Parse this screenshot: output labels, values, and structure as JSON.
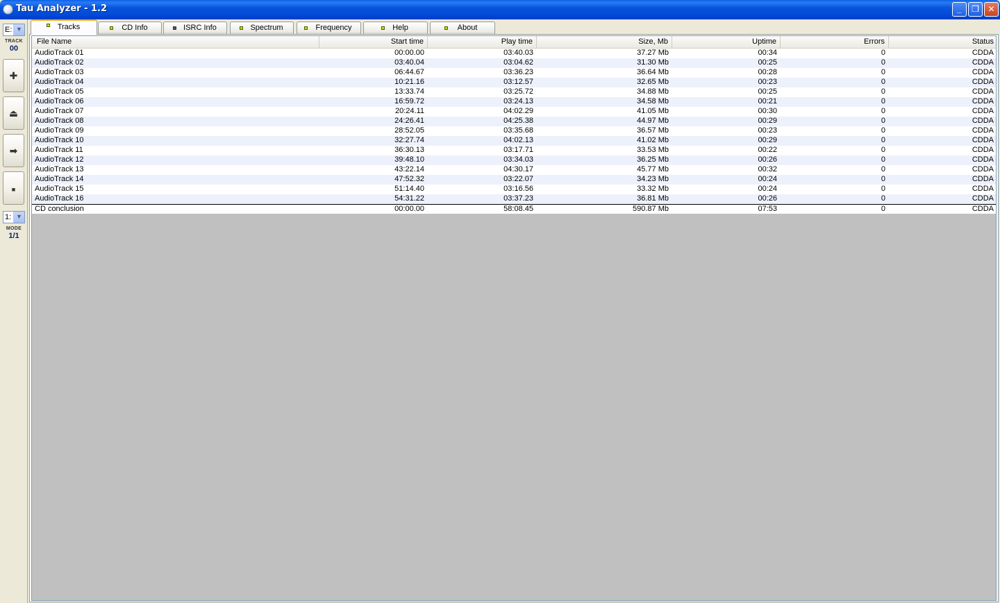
{
  "window": {
    "title": "Tau Analyzer - 1.2",
    "min_glyph": "_",
    "max_glyph": "❐",
    "close_glyph": "✕"
  },
  "sidebar": {
    "drive_value": "E:",
    "track_caption": "TRACK",
    "track_number": "00",
    "buttons": [
      {
        "name": "add",
        "glyph": "✚"
      },
      {
        "name": "eject",
        "glyph": "⏏"
      },
      {
        "name": "play",
        "glyph": "➡"
      },
      {
        "name": "stop",
        "glyph": "■"
      }
    ],
    "mode_value": "1:",
    "mode_caption": "MODE",
    "mode_value_big": "1/1"
  },
  "tabs": [
    {
      "label": "Tracks",
      "active": true,
      "indicator": "green"
    },
    {
      "label": "CD Info",
      "active": false,
      "indicator": "green"
    },
    {
      "label": "ISRC Info",
      "active": false,
      "indicator": "dark"
    },
    {
      "label": "Spectrum",
      "active": false,
      "indicator": "green"
    },
    {
      "label": "Frequency",
      "active": false,
      "indicator": "green"
    },
    {
      "label": "Help",
      "active": false,
      "indicator": "green"
    },
    {
      "label": "About",
      "active": false,
      "indicator": "green"
    }
  ],
  "table": {
    "columns": [
      "File Name",
      "Start time",
      "Play time",
      "Size, Mb",
      "Uptime",
      "Errors",
      "Status"
    ],
    "rows": [
      [
        "AudioTrack 01",
        "00:00.00",
        "03:40.03",
        "37.27 Mb",
        "00:34",
        "0",
        "CDDA"
      ],
      [
        "AudioTrack 02",
        "03:40.04",
        "03:04.62",
        "31.30 Mb",
        "00:25",
        "0",
        "CDDA"
      ],
      [
        "AudioTrack 03",
        "06:44.67",
        "03:36.23",
        "36.64 Mb",
        "00:28",
        "0",
        "CDDA"
      ],
      [
        "AudioTrack 04",
        "10:21.16",
        "03:12.57",
        "32.65 Mb",
        "00:23",
        "0",
        "CDDA"
      ],
      [
        "AudioTrack 05",
        "13:33.74",
        "03:25.72",
        "34.88 Mb",
        "00:25",
        "0",
        "CDDA"
      ],
      [
        "AudioTrack 06",
        "16:59.72",
        "03:24.13",
        "34.58 Mb",
        "00:21",
        "0",
        "CDDA"
      ],
      [
        "AudioTrack 07",
        "20:24.11",
        "04:02.29",
        "41.05 Mb",
        "00:30",
        "0",
        "CDDA"
      ],
      [
        "AudioTrack 08",
        "24:26.41",
        "04:25.38",
        "44.97 Mb",
        "00:29",
        "0",
        "CDDA"
      ],
      [
        "AudioTrack 09",
        "28:52.05",
        "03:35.68",
        "36.57 Mb",
        "00:23",
        "0",
        "CDDA"
      ],
      [
        "AudioTrack 10",
        "32:27.74",
        "04:02.13",
        "41.02 Mb",
        "00:29",
        "0",
        "CDDA"
      ],
      [
        "AudioTrack 11",
        "36:30.13",
        "03:17.71",
        "33.53 Mb",
        "00:22",
        "0",
        "CDDA"
      ],
      [
        "AudioTrack 12",
        "39:48.10",
        "03:34.03",
        "36.25 Mb",
        "00:26",
        "0",
        "CDDA"
      ],
      [
        "AudioTrack 13",
        "43:22.14",
        "04:30.17",
        "45.77 Mb",
        "00:32",
        "0",
        "CDDA"
      ],
      [
        "AudioTrack 14",
        "47:52.32",
        "03:22.07",
        "34.23 Mb",
        "00:24",
        "0",
        "CDDA"
      ],
      [
        "AudioTrack 15",
        "51:14.40",
        "03:16.56",
        "33.32 Mb",
        "00:24",
        "0",
        "CDDA"
      ],
      [
        "AudioTrack 16",
        "54:31.22",
        "03:37.23",
        "36.81 Mb",
        "00:26",
        "0",
        "CDDA"
      ]
    ],
    "total": [
      "CD conclusion",
      "00:00.00",
      "58:08.45",
      "590.87 Mb",
      "07:53",
      "0",
      "CDDA"
    ]
  }
}
